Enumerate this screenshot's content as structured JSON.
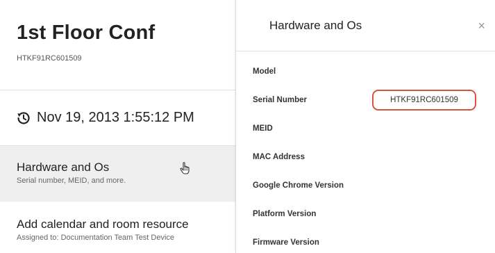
{
  "device": {
    "name": "1st Floor Conf",
    "serial": "HTKF91RC601509"
  },
  "sync": {
    "timestamp": "Nov 19, 2013 1:55:12 PM",
    "icon": "history-icon"
  },
  "nav": {
    "items": [
      {
        "title": "Hardware and Os",
        "subtitle": "Serial number, MEID, and more."
      },
      {
        "title": "Add calendar and room resource",
        "subtitle": "Assigned to: Documentation Team Test Device"
      }
    ]
  },
  "panel": {
    "title": "Hardware and Os",
    "close_label": "×",
    "rows": [
      {
        "label": "Model",
        "value": ""
      },
      {
        "label": "Serial Number",
        "value": "HTKF91RC601509"
      },
      {
        "label": "MEID",
        "value": ""
      },
      {
        "label": "MAC Address",
        "value": ""
      },
      {
        "label": "Google Chrome Version",
        "value": ""
      },
      {
        "label": "Platform Version",
        "value": ""
      },
      {
        "label": "Firmware Version",
        "value": ""
      }
    ]
  },
  "colors": {
    "highlight_border": "#d9553a",
    "active_bg": "#efefef",
    "divider": "#e2e2e2"
  }
}
